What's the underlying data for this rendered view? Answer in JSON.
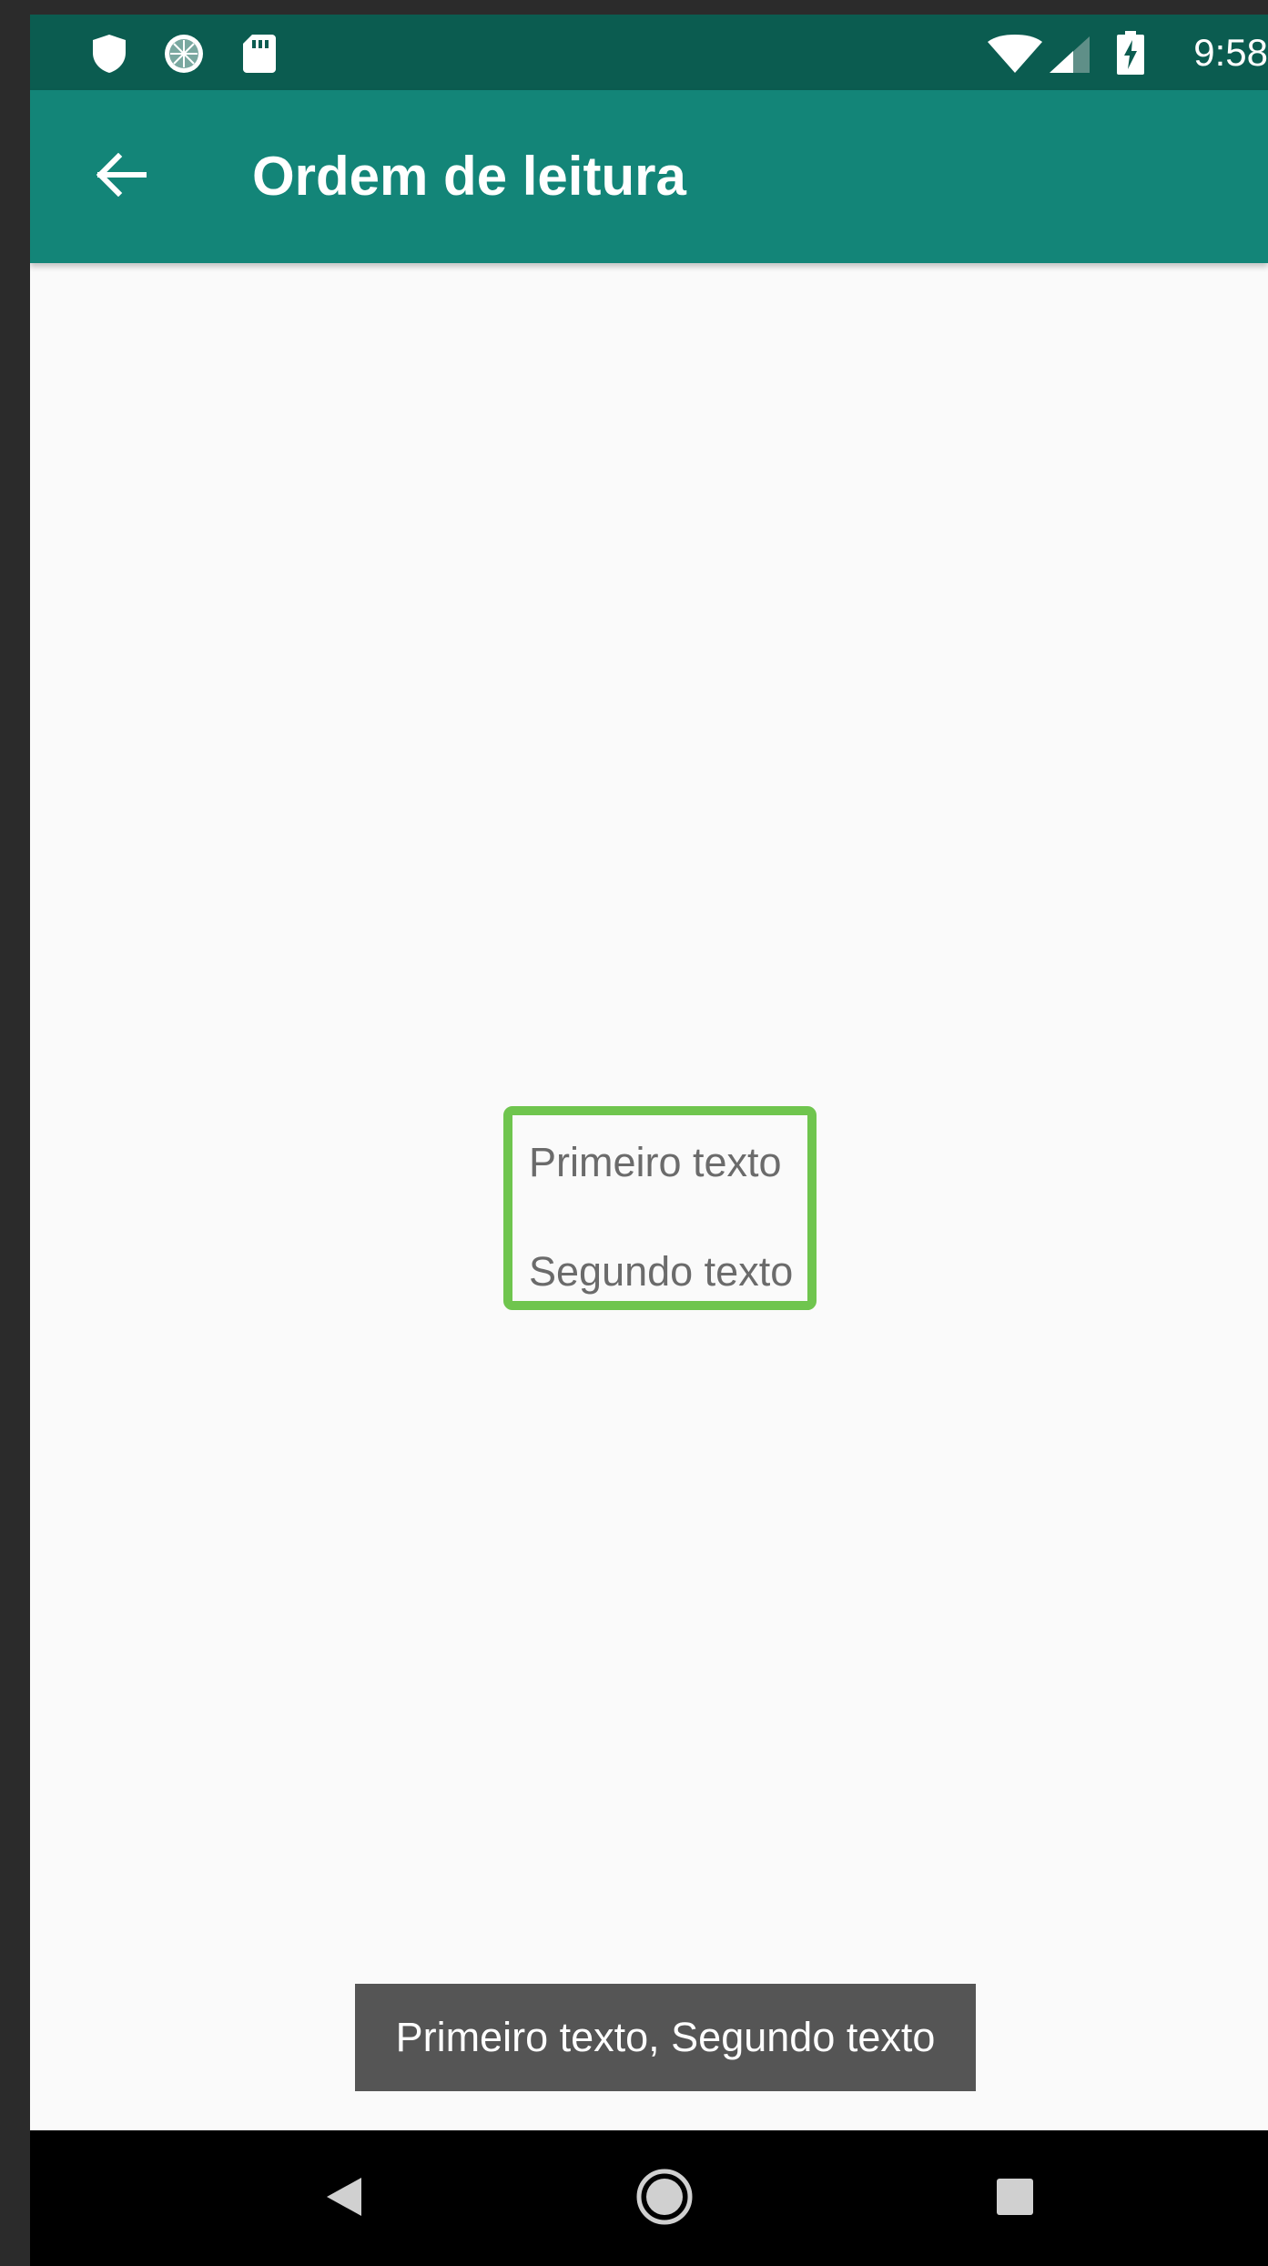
{
  "status_bar": {
    "time": "9:58",
    "left_icons": [
      "shield-icon",
      "sync-icon",
      "sd-card-icon"
    ],
    "right_icons": [
      "wifi-icon",
      "cell-signal-icon",
      "battery-charging-icon"
    ]
  },
  "app_bar": {
    "title": "Ordem de leitura",
    "back_icon": "arrow-left-icon"
  },
  "content": {
    "items": [
      {
        "label": "Primeiro texto"
      },
      {
        "label": "Segundo texto"
      }
    ],
    "focus_color": "#6fc54e"
  },
  "toast": {
    "message": "Primeiro texto, Segundo texto"
  },
  "nav_bar": {
    "buttons": [
      "back-triangle-icon",
      "home-circle-icon",
      "recents-square-icon"
    ]
  },
  "colors": {
    "status_bar": "#0b5c50",
    "app_bar": "#138578",
    "background": "#fafafa",
    "toast": "#555555"
  }
}
